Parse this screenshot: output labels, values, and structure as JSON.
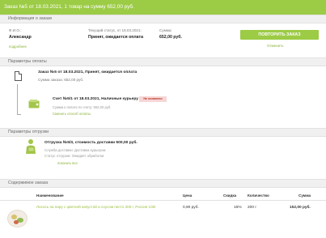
{
  "header": {
    "title": "Заказ №5 от 18.03.2021, 1 товар на сумму 652,00 руб."
  },
  "order_info": {
    "section": "Информация о заказе",
    "fio_label": "Ф.И.О.:",
    "fio_value": "Александр",
    "details_link": "подробнее",
    "status_label": "Текущий статус, от 18.03.2021:",
    "status_value": "Принят, ожидается оплата",
    "sum_label": "Сумма:",
    "sum_value": "652,00 руб.",
    "repeat_button": "ПОВТОРИТЬ ЗАКАЗ",
    "cancel_link": "Отменить"
  },
  "payment": {
    "section": "Параметры оплаты",
    "order_title": "Заказ №5 от 18.03.2021, Принят, ожидается оплата",
    "order_sum": "Сумма заказа: 652,00 руб.",
    "invoice_title": "Счет №5/1 от 18.03.2021, Наличные курьеру",
    "invoice_badge": "Не оплачено",
    "invoice_sum": "Сумма к оплате по счету: 652,00 руб.",
    "change_link": "Сменить способ оплаты"
  },
  "shipment": {
    "section": "Параметры отгрузки",
    "title": "Отгрузка №5/3, стоимость доставки 500,00 руб.",
    "service": "Служба доставки: Доставка курьером",
    "status": "Статус отгрузки: Ожидает обработки",
    "more_link": "показать все"
  },
  "contents": {
    "section": "Содержимое заказа",
    "columns": {
      "name": "Наименование",
      "price": "Цена",
      "discount": "Скидка",
      "qty": "Количество",
      "sum": "Сумма"
    },
    "rows": [
      {
        "name": "Лосось на пару с цветной капустой и соусом песто 200 г, Россия 100г",
        "price": "0,90 руб.",
        "discount": "16%",
        "qty": "200 г",
        "sum": "152,00 руб."
      }
    ]
  },
  "colors": {
    "accent": "#9ccb45",
    "badge_bg": "#f7d6d6",
    "section_bg": "#f0f0f0"
  },
  "icons": [
    "document-icon",
    "wallet-icon",
    "courier-icon",
    "product-thumbnail"
  ]
}
